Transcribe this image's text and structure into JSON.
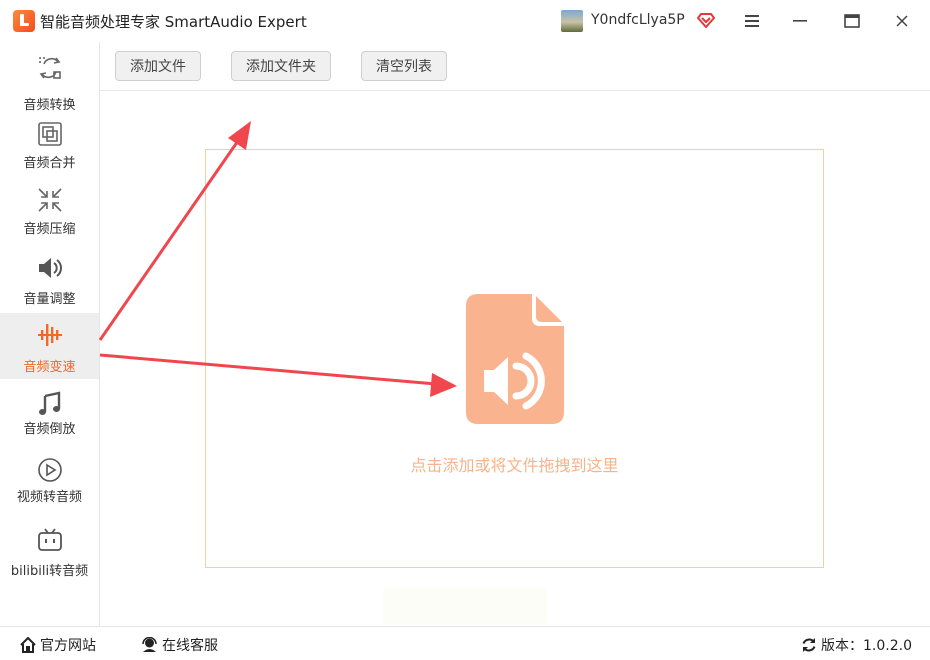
{
  "app": {
    "title": "智能音频处理专家 SmartAudio Expert"
  },
  "user": {
    "name": "Y0ndfcLlya5P"
  },
  "sidebar": {
    "items": [
      {
        "label": "音频转换",
        "icon": "convert-icon"
      },
      {
        "label": "音频合并",
        "icon": "merge-icon"
      },
      {
        "label": "音频压缩",
        "icon": "compress-icon"
      },
      {
        "label": "音量调整",
        "icon": "volume-icon"
      },
      {
        "label": "音频变速",
        "icon": "waveform-icon",
        "active": true
      },
      {
        "label": "音频倒放",
        "icon": "music-note-icon"
      },
      {
        "label": "视频转音频",
        "icon": "play-icon"
      },
      {
        "label": "bilibili转音频",
        "icon": "bilibili-tv-icon"
      }
    ]
  },
  "toolbar": {
    "add_file": "添加文件",
    "add_folder": "添加文件夹",
    "clear_list": "清空列表"
  },
  "dropzone": {
    "hint": "点击添加或将文件拖拽到这里"
  },
  "footer": {
    "website": "官方网站",
    "support": "在线客服",
    "version": "版本：1.0.2.0"
  },
  "colors": {
    "accent": "#ef6a2a",
    "file_icon": "#f9b48f",
    "hint": "#f5b48b",
    "dropzone_border": "#f1cfa9",
    "arrow": "#f0464e"
  }
}
